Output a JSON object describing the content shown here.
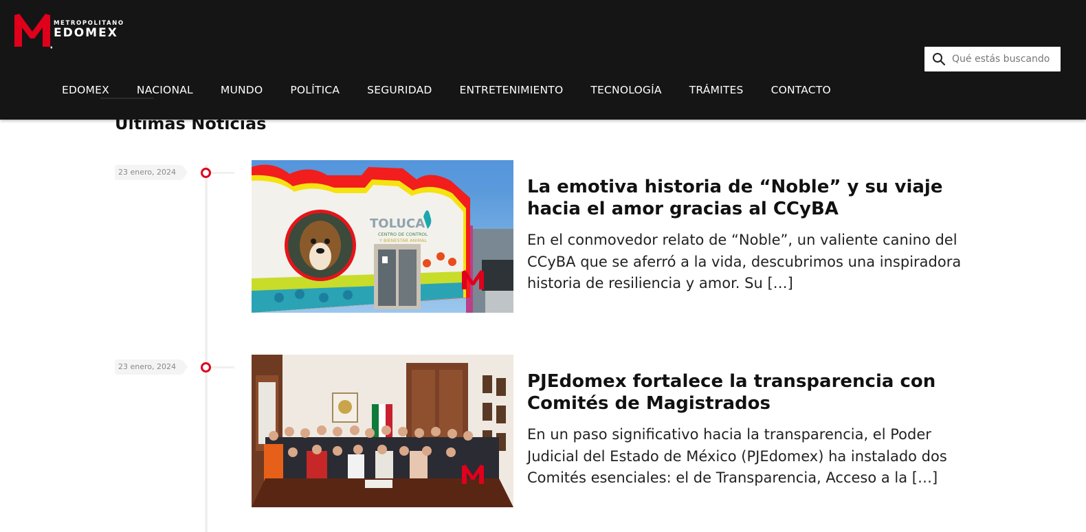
{
  "brand": {
    "small": "METROPOLITANO",
    "big": "EDOMEX",
    "accent": "#e0001b"
  },
  "search": {
    "placeholder": "Qué estás buscando"
  },
  "nav": [
    "EDOMEX",
    "NACIONAL",
    "MUNDO",
    "POLÍTICA",
    "SEGURIDAD",
    "ENTRETENIMIENTO",
    "TECNOLOGÍA",
    "TRÁMITES",
    "CONTACTO"
  ],
  "section": {
    "title": "Últimas Noticias"
  },
  "articles": [
    {
      "date": "23 enero, 2024",
      "title": "La emotiva historia de “Noble” y su viaje hacia el amor gracias al CCyBA",
      "excerpt": "En el conmovedor relato de “Noble”, un valiente canino del CCyBA que se aferró a la vida, descubrimos una inspiradora historia de resiliencia y amor. Su […]",
      "image_text": [
        "TOLUCA",
        "CENTRO DE CONTROL",
        "Y BIENESTAR ANIMAL"
      ]
    },
    {
      "date": "23 enero, 2024",
      "title": "PJEdomex fortalece la transparencia con Comités de Magistrados",
      "excerpt": "En un paso significativo hacia la transparencia, el Poder Judicial del Estado de México (PJEdomex) ha instalado dos Comités esenciales: el de Transparencia, Acceso a la […]"
    }
  ]
}
